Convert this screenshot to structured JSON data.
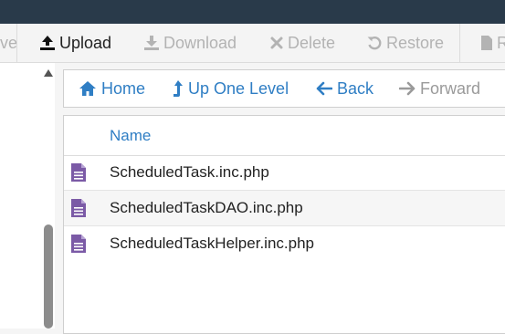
{
  "toolbar": {
    "items": [
      {
        "label": "ve",
        "icon": "save-icon",
        "enabled": false
      },
      {
        "label": "Upload",
        "icon": "upload-icon",
        "enabled": true
      },
      {
        "label": "Download",
        "icon": "download-icon",
        "enabled": false
      },
      {
        "label": "Delete",
        "icon": "delete-icon",
        "enabled": false
      },
      {
        "label": "Restore",
        "icon": "restore-icon",
        "enabled": false
      },
      {
        "label": "R",
        "icon": "file-icon",
        "enabled": false
      }
    ]
  },
  "nav": {
    "home": "Home",
    "up": "Up One Level",
    "back": "Back",
    "forward": "Forward"
  },
  "table": {
    "header_name": "Name",
    "rows": [
      {
        "name": "ScheduledTask.inc.php",
        "icon": "php-file-icon"
      },
      {
        "name": "ScheduledTaskDAO.inc.php",
        "icon": "php-file-icon"
      },
      {
        "name": "ScheduledTaskHelper.inc.php",
        "icon": "php-file-icon"
      }
    ]
  },
  "colors": {
    "topbar": "#293a4a",
    "link": "#2f7ec4",
    "file_icon": "#7b5aa6",
    "disabled": "#b3b3b3"
  }
}
